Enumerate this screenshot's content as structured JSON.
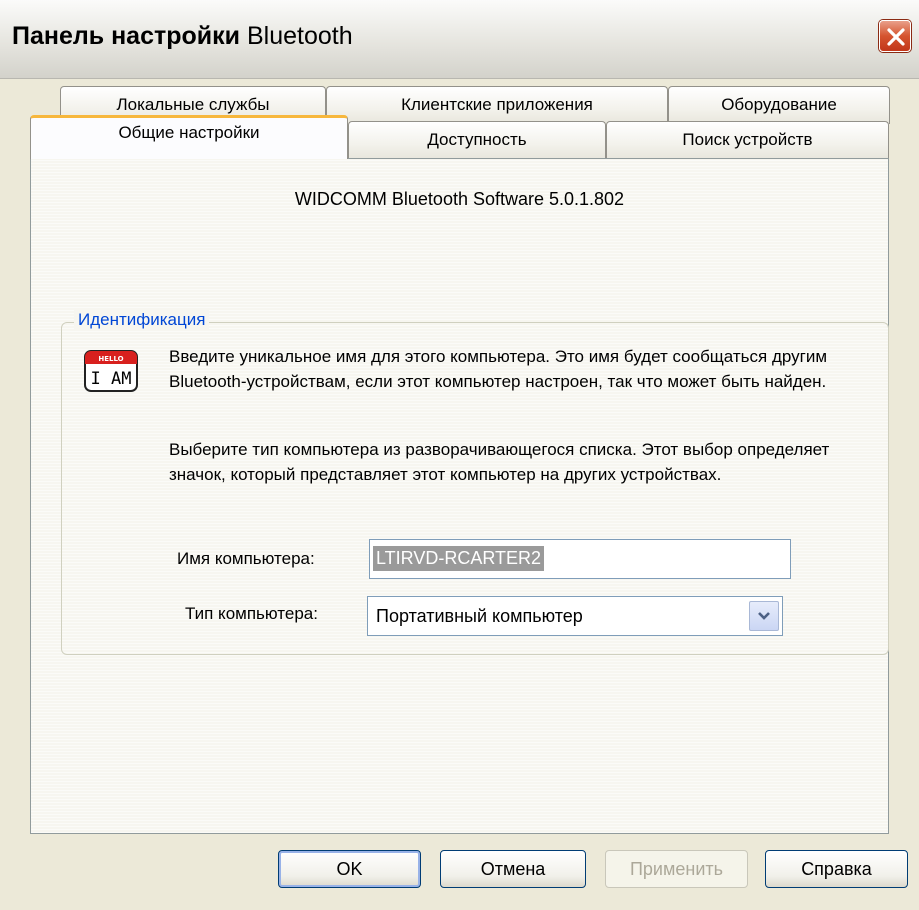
{
  "window": {
    "title_bold": "Панель настройки",
    "title_rest": "Bluetooth"
  },
  "tabs_back": [
    {
      "label": "Локальные службы"
    },
    {
      "label": "Клиентские приложения"
    },
    {
      "label": "Оборудование"
    }
  ],
  "tabs_front": [
    {
      "label": "Общие настройки",
      "active": true
    },
    {
      "label": "Доступность",
      "active": false
    },
    {
      "label": "Поиск устройств",
      "active": false
    }
  ],
  "panel": {
    "version": "WIDCOMM Bluetooth Software 5.0.1.802",
    "group_label": "Идентификация",
    "icon": "hello-i-am-icon",
    "icon_text_top": "HELLO",
    "icon_text_main": "I AM",
    "paragraph1": "Введите уникальное имя для этого компьютера.  Это имя будет сообщаться другим Bluetooth-устройствам, если этот компьютер настроен, так что может быть найден.",
    "paragraph2": "Выберите тип компьютера из разворачивающегося списка.  Этот выбор определяет значок, который представляет этот компьютер на других устройствах.",
    "name_label": "Имя компьютера:",
    "name_value": "LTIRVD-RCARTER2",
    "type_label": "Тип компьютера:",
    "type_value": "Портативный компьютер"
  },
  "buttons": {
    "ok": "OK",
    "cancel": "Отмена",
    "apply": "Применить",
    "help": "Справка"
  },
  "colors": {
    "accent": "#0046d5",
    "active_tab_highlight": "#f7b73c",
    "close_button": "#d5542f"
  }
}
